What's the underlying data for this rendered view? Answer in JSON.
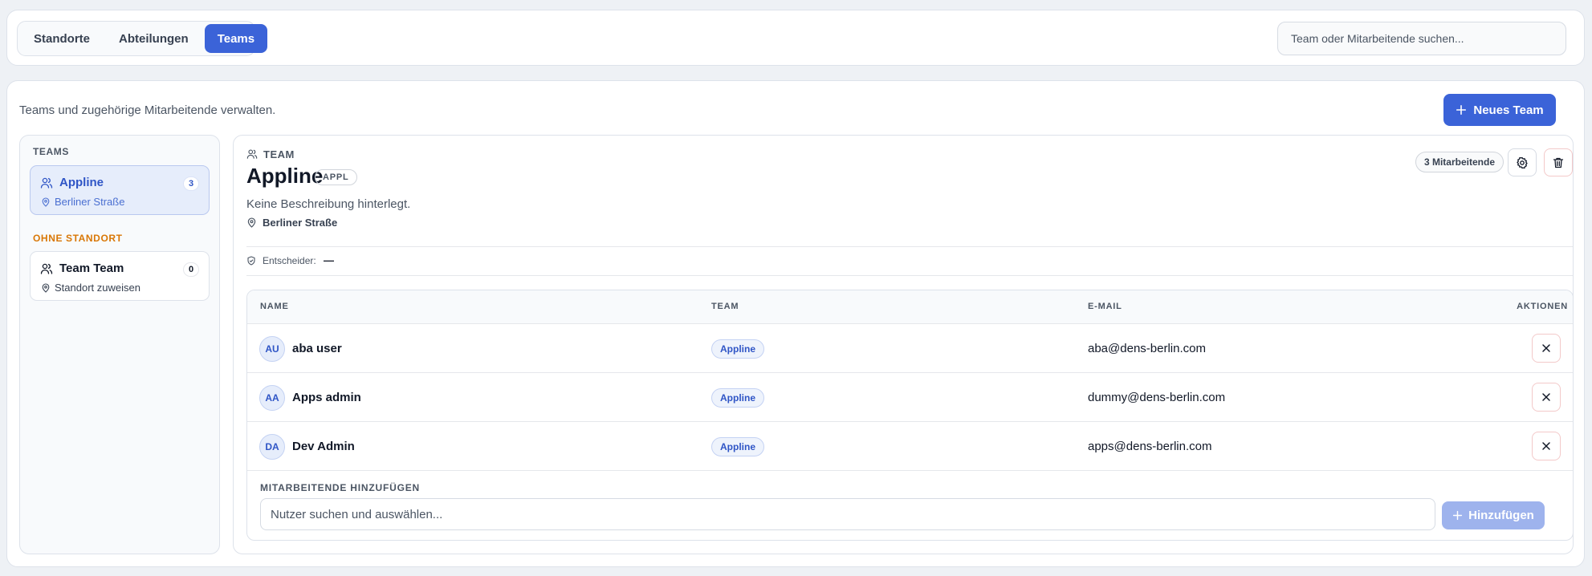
{
  "nav": {
    "tabs": [
      {
        "label": "Standorte",
        "active": false
      },
      {
        "label": "Abteilungen",
        "active": false
      },
      {
        "label": "Teams",
        "active": true
      }
    ],
    "search_placeholder": "Team oder Mitarbeitende suchen..."
  },
  "main": {
    "subtitle": "Teams und zugehörige Mitarbeitende verwalten.",
    "new_team_label": "Neues Team"
  },
  "sidebar": {
    "teams_heading": "TEAMS",
    "ohne_heading": "OHNE STANDORT",
    "teams": [
      {
        "name": "Appline",
        "location": "Berliner Straße",
        "count": "3",
        "selected": true
      },
      {
        "name": "Team Team",
        "location": "Standort zuweisen",
        "count": "0",
        "selected": false
      }
    ]
  },
  "detail": {
    "kicker": "TEAM",
    "title": "Appline",
    "code": "APPL",
    "description": "Keine Beschreibung hinterlegt.",
    "location": "Berliner Straße",
    "entscheider_label": "Entscheider:",
    "entscheider_value": "—",
    "member_count": "3 Mitarbeitende"
  },
  "table": {
    "headers": {
      "name": "NAME",
      "team": "TEAM",
      "email": "E-MAIL",
      "actions": "AKTIONEN"
    },
    "rows": [
      {
        "initials": "AU",
        "name": "aba user",
        "team": "Appline",
        "email": "aba@dens-berlin.com"
      },
      {
        "initials": "AA",
        "name": "Apps admin",
        "team": "Appline",
        "email": "dummy@dens-berlin.com"
      },
      {
        "initials": "DA",
        "name": "Dev Admin",
        "team": "Appline",
        "email": "apps@dens-berlin.com"
      }
    ]
  },
  "add": {
    "label": "MITARBEITENDE HINZUFÜGEN",
    "placeholder": "Nutzer suchen und auswählen...",
    "button": "Hinzufügen"
  },
  "colors": {
    "accent": "#3b63d8",
    "accent_light": "#e6edfb",
    "warning": "#d97706",
    "danger_border": "#f3c9c9"
  }
}
